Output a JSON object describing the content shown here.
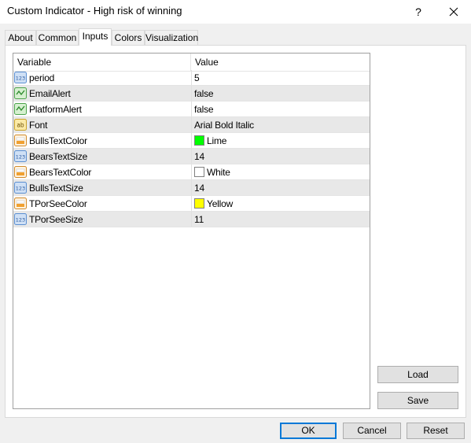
{
  "window": {
    "title": "Custom Indicator - High risk of winning",
    "help_label": "?",
    "close_label": "✕"
  },
  "tabs": [
    {
      "label": "About"
    },
    {
      "label": "Common"
    },
    {
      "label": "Inputs",
      "active": true
    },
    {
      "label": "Colors"
    },
    {
      "label": "Visualization"
    }
  ],
  "grid": {
    "col_variable": "Variable",
    "col_value": "Value",
    "rows": [
      {
        "name": "period",
        "value": "5",
        "icon": "int-icon"
      },
      {
        "name": "EmailAlert",
        "value": "false",
        "icon": "bool-icon"
      },
      {
        "name": "PlatformAlert",
        "value": "false",
        "icon": "bool-icon"
      },
      {
        "name": "Font",
        "value": "Arial Bold Italic",
        "icon": "string-icon"
      },
      {
        "name": "BullsTextColor",
        "value": "Lime",
        "icon": "color-icon",
        "swatch": "#00ff00"
      },
      {
        "name": "BearsTextSize",
        "value": "14",
        "icon": "int-icon"
      },
      {
        "name": "BearsTextColor",
        "value": "White",
        "icon": "color-icon",
        "swatch": "#ffffff"
      },
      {
        "name": "BullsTextSize",
        "value": "14",
        "icon": "int-icon"
      },
      {
        "name": "TPorSeeColor",
        "value": "Yellow",
        "icon": "color-icon",
        "swatch": "#ffff00"
      },
      {
        "name": "TPorSeeSize",
        "value": "11",
        "icon": "int-icon"
      }
    ]
  },
  "side_buttons": {
    "load": "Load",
    "save": "Save"
  },
  "footer": {
    "ok": "OK",
    "cancel": "Cancel",
    "reset": "Reset"
  }
}
